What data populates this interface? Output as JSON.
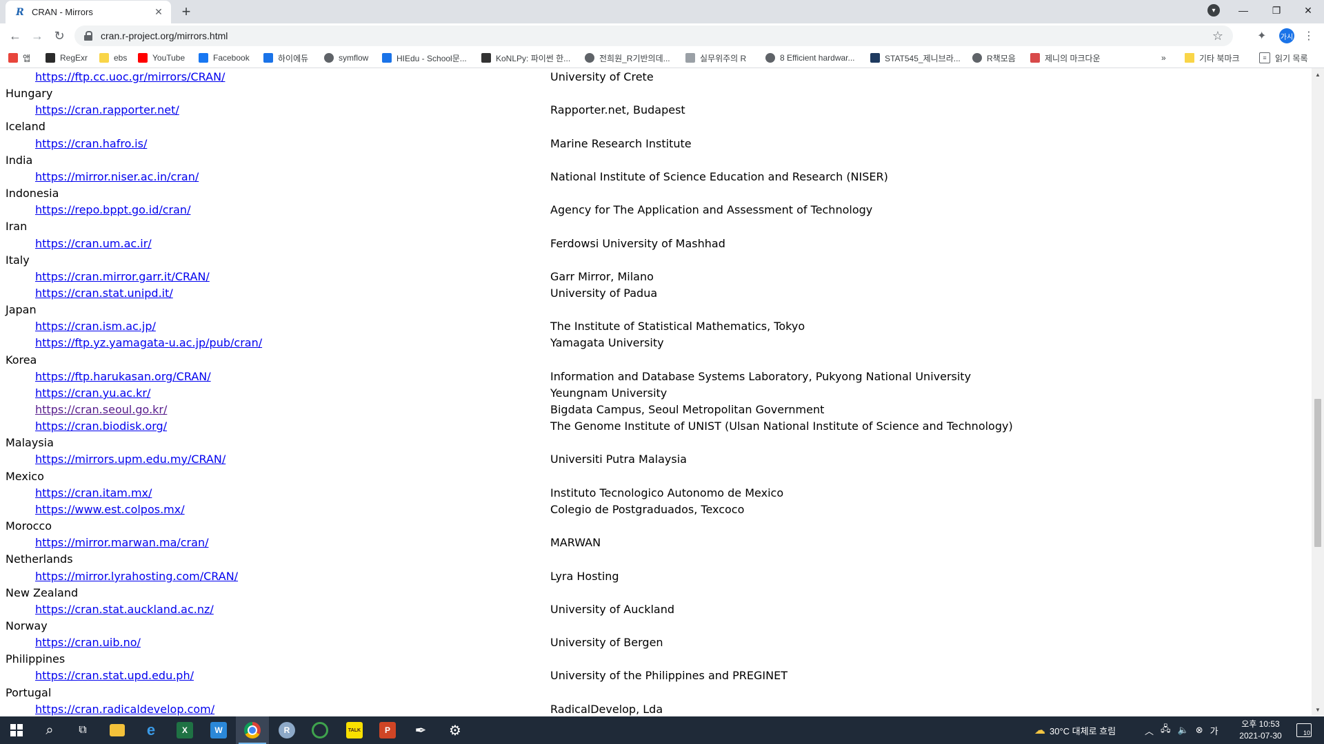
{
  "browser": {
    "tab_title": "CRAN - Mirrors",
    "tab_favicon": "R",
    "url": "cran.r-project.org/mirrors.html",
    "profile_initials": "가시"
  },
  "bookmarks": [
    {
      "label": "앱",
      "icon": "apps-grid-icon",
      "color": "#e8453c"
    },
    {
      "label": "RegExr",
      "icon": "regexr-icon",
      "color": "#2b2b2b"
    },
    {
      "label": "ebs",
      "icon": "folder-icon",
      "color": "#f9d548"
    },
    {
      "label": "YouTube",
      "icon": "youtube-icon",
      "color": "#ff0000"
    },
    {
      "label": "Facebook",
      "icon": "facebook-icon",
      "color": "#1877f2"
    },
    {
      "label": "하이에듀",
      "icon": "hiedu-icon",
      "color": "#1a73e8"
    },
    {
      "label": "symflow",
      "icon": "globe-icon",
      "color": "#5f6368"
    },
    {
      "label": "HIEdu - School문...",
      "icon": "hiedu-icon",
      "color": "#1a73e8"
    },
    {
      "label": "KoNLPy: 파이썬 한...",
      "icon": "konlpy-icon",
      "color": "#333333"
    },
    {
      "label": "전희원_R기반의데...",
      "icon": "globe-icon",
      "color": "#5f6368"
    },
    {
      "label": "실무위주의 R",
      "icon": "page-icon",
      "color": "#9aa0a6"
    },
    {
      "label": "8 Efficient hardwar...",
      "icon": "globe-icon",
      "color": "#5f6368"
    },
    {
      "label": "STAT545_제니브라...",
      "icon": "stat545-icon",
      "color": "#1e3a5f"
    },
    {
      "label": "R책모음",
      "icon": "globe-icon",
      "color": "#5f6368"
    },
    {
      "label": "제니의 마크다운",
      "icon": "blog-icon",
      "color": "#d84a4a"
    }
  ],
  "bookmarks_overflow": "»",
  "bookmarks_right": [
    {
      "label": "기타 북마크",
      "icon": "folder-icon"
    },
    {
      "label": "읽기 목록",
      "icon": "reading-list-icon"
    }
  ],
  "mirrors": [
    {
      "type": "link",
      "url": "https://ftp.cc.uoc.gr/mirrors/CRAN/",
      "desc": "University of Crete"
    },
    {
      "type": "country",
      "name": "Hungary"
    },
    {
      "type": "link",
      "url": "https://cran.rapporter.net/",
      "desc": "Rapporter.net, Budapest"
    },
    {
      "type": "country",
      "name": "Iceland"
    },
    {
      "type": "link",
      "url": "https://cran.hafro.is/",
      "desc": "Marine Research Institute"
    },
    {
      "type": "country",
      "name": "India"
    },
    {
      "type": "link",
      "url": "https://mirror.niser.ac.in/cran/",
      "desc": "National Institute of Science Education and Research (NISER)"
    },
    {
      "type": "country",
      "name": "Indonesia"
    },
    {
      "type": "link",
      "url": "https://repo.bppt.go.id/cran/",
      "desc": "Agency for The Application and Assessment of Technology"
    },
    {
      "type": "country",
      "name": "Iran"
    },
    {
      "type": "link",
      "url": "https://cran.um.ac.ir/",
      "desc": "Ferdowsi University of Mashhad"
    },
    {
      "type": "country",
      "name": "Italy"
    },
    {
      "type": "link",
      "url": "https://cran.mirror.garr.it/CRAN/",
      "desc": "Garr Mirror, Milano"
    },
    {
      "type": "link",
      "url": "https://cran.stat.unipd.it/",
      "desc": "University of Padua"
    },
    {
      "type": "country",
      "name": "Japan"
    },
    {
      "type": "link",
      "url": "https://cran.ism.ac.jp/",
      "desc": "The Institute of Statistical Mathematics, Tokyo"
    },
    {
      "type": "link",
      "url": "https://ftp.yz.yamagata-u.ac.jp/pub/cran/",
      "desc": "Yamagata University"
    },
    {
      "type": "country",
      "name": "Korea"
    },
    {
      "type": "link",
      "url": "https://ftp.harukasan.org/CRAN/",
      "desc": "Information and Database Systems Laboratory, Pukyong National University"
    },
    {
      "type": "link",
      "url": "https://cran.yu.ac.kr/",
      "desc": "Yeungnam University"
    },
    {
      "type": "link",
      "url": "https://cran.seoul.go.kr/",
      "desc": "Bigdata Campus, Seoul Metropolitan Government",
      "visited": true
    },
    {
      "type": "link",
      "url": "https://cran.biodisk.org/",
      "desc": "The Genome Institute of UNIST (Ulsan National Institute of Science and Technology)"
    },
    {
      "type": "country",
      "name": "Malaysia"
    },
    {
      "type": "link",
      "url": "https://mirrors.upm.edu.my/CRAN/",
      "desc": "Universiti Putra Malaysia"
    },
    {
      "type": "country",
      "name": "Mexico"
    },
    {
      "type": "link",
      "url": "https://cran.itam.mx/",
      "desc": "Instituto Tecnologico Autonomo de Mexico"
    },
    {
      "type": "link",
      "url": "https://www.est.colpos.mx/",
      "desc": "Colegio de Postgraduados, Texcoco"
    },
    {
      "type": "country",
      "name": "Morocco"
    },
    {
      "type": "link",
      "url": "https://mirror.marwan.ma/cran/",
      "desc": "MARWAN"
    },
    {
      "type": "country",
      "name": "Netherlands"
    },
    {
      "type": "link",
      "url": "https://mirror.lyrahosting.com/CRAN/",
      "desc": "Lyra Hosting"
    },
    {
      "type": "country",
      "name": "New Zealand"
    },
    {
      "type": "link",
      "url": "https://cran.stat.auckland.ac.nz/",
      "desc": "University of Auckland"
    },
    {
      "type": "country",
      "name": "Norway"
    },
    {
      "type": "link",
      "url": "https://cran.uib.no/",
      "desc": "University of Bergen"
    },
    {
      "type": "country",
      "name": "Philippines"
    },
    {
      "type": "link",
      "url": "https://cran.stat.upd.edu.ph/",
      "desc": "University of the Philippines and PREGINET"
    },
    {
      "type": "country",
      "name": "Portugal"
    },
    {
      "type": "link",
      "url": "https://cran.radicaldevelop.com/",
      "desc": "RadicalDevelop, Lda"
    }
  ],
  "taskbar": {
    "apps": [
      {
        "name": "search-icon"
      },
      {
        "name": "task-view-icon"
      },
      {
        "name": "file-explorer-icon"
      },
      {
        "name": "edge-icon"
      },
      {
        "name": "excel-icon"
      },
      {
        "name": "word-icon"
      },
      {
        "name": "chrome-icon",
        "active": true
      },
      {
        "name": "r-icon",
        "label": "R"
      },
      {
        "name": "rstudio-icon"
      },
      {
        "name": "kakaotalk-icon",
        "label": "TALK"
      },
      {
        "name": "powerpoint-icon",
        "label": "P"
      },
      {
        "name": "inkscape-icon"
      },
      {
        "name": "settings-icon"
      }
    ],
    "weather": "30°C  대체로 흐림",
    "clock_time": "오후 10:53",
    "clock_date": "2021-07-30",
    "notification_count": "10"
  }
}
